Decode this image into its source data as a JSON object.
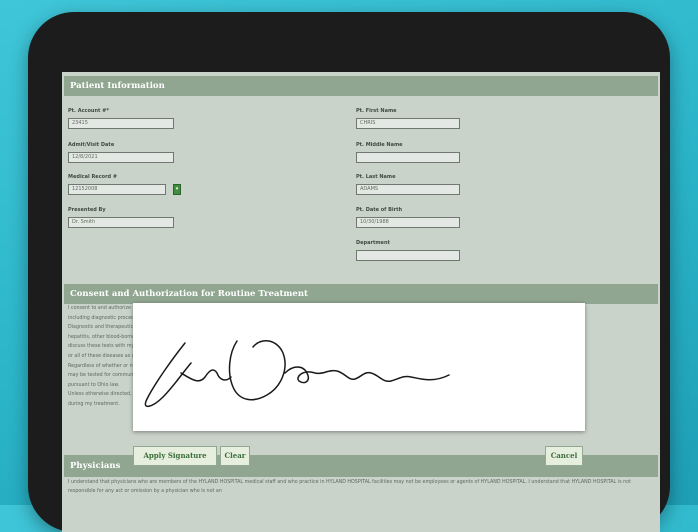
{
  "sections": {
    "patient_info": "Patient Information",
    "consent": "Consent and Authorization for Routine Treatment",
    "physicians": "Physicians"
  },
  "fields": {
    "account_label": "Pt. Account #*",
    "account_value": "23415",
    "admit_label": "Admit/Visit Date",
    "admit_value": "12/8/2021",
    "mrn_label": "Medical Record #",
    "mrn_value": "12152008",
    "presented_label": "Presented By",
    "presented_value": "Dr. Smith",
    "first_label": "Pt. First Name",
    "first_value": "CHRIS",
    "middle_label": "Pt. Middle Name",
    "middle_value": "",
    "last_label": "Pt. Last Name",
    "last_value": "ADAMS",
    "dob_label": "Pt. Date of Birth",
    "dob_value": "10/30/1988",
    "dept_label": "Department",
    "dept_value": ""
  },
  "consent_text": "I consent to and authorize the physicians and practitioners of HYLAND HOSPITAL to perform routine health care services,\nincluding diagnostic procedures, testing, laboratory and radiology examinations, and medical treatment as my physician directs.\nDiagnostic and therapeutic testing may include tests for communicable diseases such as human immunodeficiency virus (HIV),\nhepatitis, other blood-borne pathogens and sexually transmitted infections. I understand that the results of the tests that I can\ndiscuss these tests with my physician, and that I have the right to refuse testing. I consent to be tested for any\nor all of these diseases as ordered by my physician.\nRegardless of whether or not I am present, if a health care worker is exposed to my blood, I agree that my blood\nmay be tested for communicable diseases and that results may be disclosed to the exposed health care worker\npursuant to Ohio law.\nUnless otherwise directed, I consent to the disposal of any tissue, organs or body parts removed from my body\nduring my treatment.",
  "physicians_text": "I understand that physicians who are members of the HYLAND HOSPITAL medical staff and who practice in HYLAND HOSPITAL facilities may not be employees or agents of HYLAND HOSPITAL. I understand that HYLAND HOSPITAL is not responsible for any act or omission by a physician who is not an",
  "buttons": {
    "apply": "Apply Signature",
    "clear": "Clear",
    "cancel": "Cancel"
  },
  "signature": {
    "signer": "Chris Adams"
  },
  "colors": {
    "header_bg": "#90a690",
    "screen_bg": "#c9d3c9",
    "button_text": "#3a6d3a",
    "backdrop": "#2ab3c8",
    "tablet_frame": "#1c1c1c"
  }
}
